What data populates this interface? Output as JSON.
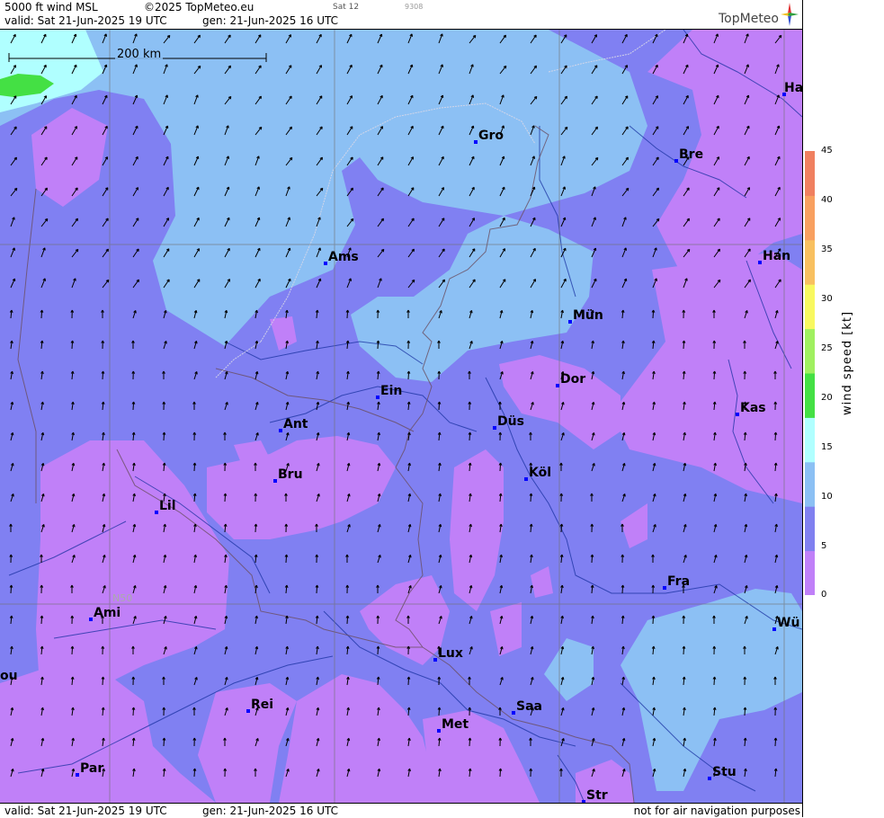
{
  "header": {
    "product": "5000 ft wind MSL",
    "copyright": "©2025 TopMeteo.eu",
    "tab": "Sat 12",
    "code": "9308",
    "valid": "valid:  Sat  21-Jun-2025  19 UTC",
    "gen": "gen: 21-Jun-2025 16 UTC",
    "brand": "TopMeteo"
  },
  "footer": {
    "valid": "valid:  Sat  21-Jun-2025  19 UTC",
    "gen": "gen: 21-Jun-2025 16 UTC",
    "note": "not for air navigation purposes"
  },
  "map": {
    "scale_label": "200 km",
    "grid_label": "N50",
    "cities": [
      "Ha",
      "Gro",
      "Bre",
      "Ams",
      "Han",
      "Mün",
      "Dor",
      "Ein",
      "Kas",
      "Düs",
      "Ant",
      "Köl",
      "Bru",
      "Lil",
      "Fra",
      "Ami",
      "Wü",
      "Lux",
      "ou",
      "Rei",
      "Saa",
      "Met",
      "Stu",
      "Par",
      "Str"
    ]
  },
  "legend": {
    "unit": "wind  speed  [kt]",
    "ticks": [
      "45",
      "40",
      "35",
      "30",
      "25",
      "20",
      "15",
      "10",
      "5",
      "0"
    ],
    "colors": [
      "#c080f8",
      "#8080f0",
      "#8cc0f4",
      "#b0ffff",
      "#44e044",
      "#a0f060",
      "#f8f860",
      "#f8c060",
      "#f8a060",
      "#f08060"
    ]
  },
  "colors": {
    "speed_0_5": "#c080f8",
    "speed_5_10": "#8080f0",
    "speed_10_15": "#8cc0f4",
    "speed_15_20": "#b0ffff",
    "speed_20_25": "#44e044"
  }
}
